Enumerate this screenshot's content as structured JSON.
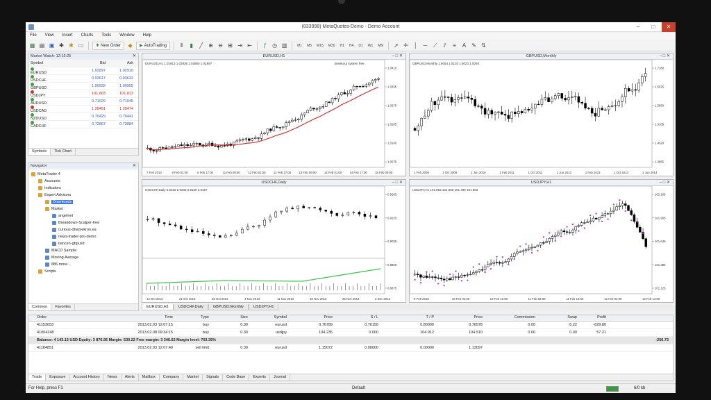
{
  "window": {
    "title": "(833998) MetaQuotes-Demo - Demo Account"
  },
  "menu": [
    "File",
    "View",
    "Insert",
    "Charts",
    "Tools",
    "Window",
    "Help"
  ],
  "toolbar": {
    "new_order": "New Order",
    "autotrading": "AutoTrading",
    "timeframes": [
      "M1",
      "M5",
      "M15",
      "M30",
      "H1",
      "H4",
      "D1",
      "W1",
      "MN"
    ]
  },
  "market_watch": {
    "title": "Market Watch: 12:15:25",
    "columns": [
      "Symbol",
      "Bid",
      "Ask"
    ],
    "rows": [
      {
        "symbol": "EURUSD",
        "bid": "1.02897",
        "ask": "1.02910",
        "down": false
      },
      {
        "symbol": "USDCHF",
        "bid": "0.93617",
        "ask": "0.93632",
        "down": false
      },
      {
        "symbol": "GBPUSD",
        "bid": "1.50939",
        "ask": "1.50955",
        "down": false
      },
      {
        "symbol": "USDJPY",
        "bid": "101.803",
        "ask": "101.813",
        "down": true
      },
      {
        "symbol": "AUDUSD",
        "bid": "0.71029",
        "ask": "0.71045",
        "down": false
      },
      {
        "symbol": "USDCAD",
        "bid": "1.28451",
        "ask": "1.28474",
        "down": true
      },
      {
        "symbol": "NZDUSD",
        "bid": "0.70429",
        "ask": "0.70441",
        "down": false
      },
      {
        "symbol": "CADCHF",
        "bid": "0.72867",
        "ask": "0.72884",
        "down": false
      }
    ],
    "tabs": [
      "Symbols",
      "Tick Chart"
    ]
  },
  "navigator": {
    "title": "Navigator",
    "items": [
      {
        "label": "MetaTrader 4",
        "level": 0,
        "icon": "folder",
        "sel": false
      },
      {
        "label": "Accounts",
        "level": 1,
        "icon": "folder",
        "sel": false
      },
      {
        "label": "Indicators",
        "level": 1,
        "icon": "folder",
        "sel": false
      },
      {
        "label": "Expert Advisors",
        "level": 1,
        "icon": "folder",
        "sel": false
      },
      {
        "label": "Downloads",
        "level": 2,
        "icon": "folder",
        "sel": true
      },
      {
        "label": "Market",
        "level": 2,
        "icon": "folder",
        "sel": false
      },
      {
        "label": "angelnet",
        "level": 3,
        "icon": "robot",
        "sel": false
      },
      {
        "label": "Breakdown-Scalper-free",
        "level": 3,
        "icon": "robot",
        "sel": false
      },
      {
        "label": "curious-dhamekron.ea",
        "level": 3,
        "icon": "robot",
        "sel": false
      },
      {
        "label": "news-trader-pro-demo",
        "level": 3,
        "icon": "robot",
        "sel": false
      },
      {
        "label": "tiancen-gbpusd",
        "level": 3,
        "icon": "robot",
        "sel": false
      },
      {
        "label": "MACD Sample",
        "level": 2,
        "icon": "robot",
        "sel": false
      },
      {
        "label": "Moving Average",
        "level": 2,
        "icon": "robot",
        "sel": false
      },
      {
        "label": "886 more...",
        "level": 2,
        "icon": "robot",
        "sel": false
      },
      {
        "label": "Scripts",
        "level": 1,
        "icon": "folder",
        "sel": false
      }
    ],
    "tabs": [
      "Common",
      "Favorites"
    ]
  },
  "charts": [
    {
      "title": "EURUSD,H1",
      "info": "EURUSD,H1  1.02913 1.02936 1.02880 1.02897",
      "label": "Breakout system free",
      "prices": [
        "1.0410",
        "1.0335",
        "1.0270",
        "1.0205",
        "1.0140",
        "1.0075"
      ],
      "dates": [
        "7 Feb 2013",
        "8 Feb 01:00",
        "8 Feb 17:00",
        "11 Feb 09:00",
        "12 Feb 01:00",
        "12 Feb 17:00",
        "13 Feb 09:00",
        "14 Feb 01:00",
        "14 Feb 17:00",
        "15 Feb 09:00"
      ]
    },
    {
      "title": "GBPUSD,Monthly",
      "info": "GBPUSD,Monthly  1.5054 1.5102 1.5023 1.5093",
      "label": "",
      "prices": [
        "1.7180",
        "1.6515",
        "1.5850",
        "1.5185",
        "1.4520",
        "1.3855"
      ],
      "dates": [
        "1 Feb 2009",
        "1 Oct 2009",
        "1 Jun 2010",
        "1 Feb 2011",
        "1 Oct 2011",
        "1 Jun 2012",
        "1 Feb 2013",
        "1 Oct 2013",
        "1 Jun 2014"
      ]
    },
    {
      "title": "USDCHF,Daily",
      "info": "USDCHF,Daily  0.9182 0.9203 0.9150 0.9157",
      "label": "",
      "prices": [
        "0.9205",
        "0.9120",
        "0.9035",
        "0.8950",
        "0.8875"
      ],
      "dates": [
        "14 Oct 2013",
        "21 Oct 2013",
        "28 Oct 2013",
        "4 Nov 2013",
        "11 Nov 2013",
        "18 Nov 2013",
        "25 Nov 2013",
        "2 Dec 2013"
      ]
    },
    {
      "title": "USDJPY,H1",
      "info": "USDJPY,H1  101.853 101.858 101.789 101.803",
      "label": "",
      "prices": [
        "102.165",
        "101.905",
        "101.645",
        "101.385",
        "101.125"
      ],
      "dates": [
        "9 Feb 2016",
        "10 Feb 02:00",
        "10 Feb 12:00",
        "11 Feb 02:00",
        "11 Feb 12:00",
        "12 Feb 02:00",
        "12 Feb 12:00"
      ]
    }
  ],
  "chart_tabs": [
    "EURUSD,H1",
    "USDCHF,Daily",
    "GBPUSD,Monthly",
    "USDJPY,H1"
  ],
  "terminal": {
    "columns": [
      "Order",
      "Time",
      "Type",
      "Size",
      "Symbol",
      "Price",
      "S / L",
      "T / P",
      "Price",
      "Commission",
      "Swap",
      "Profit"
    ],
    "rows": [
      [
        "41153053",
        "2013.02.03 12:07:15",
        "buy",
        "0.30",
        "eurusd",
        "0.76789",
        "0.76150",
        "0.80000",
        "0.76578",
        "0.00",
        "-5.22",
        "-629.80"
      ],
      [
        "41004248",
        "2013.02.08 09:34:15",
        "buy",
        "0.30",
        "usdjpy",
        "104.235",
        "0.000",
        "104.912",
        "104.510",
        "0.00",
        "0.00",
        "57.21"
      ]
    ],
    "balance": "Balance: 4 143.13 USD  Equity: 3 876.95  Margin: 530.22  Free margin: 3 346.62  Margin level: 703.35%",
    "balance_profit": "-256.73",
    "order": [
      "41184851",
      "2013.02.03 12:07:40",
      "sell limit",
      "0.30",
      "eurusd",
      "1.15072",
      "0.00000",
      "0.00000",
      "1.13097",
      "",
      "",
      ""
    ],
    "tabs": [
      "Trade",
      "Exposure",
      "Account History",
      "News",
      "Alerts",
      "Mailbox",
      "Company",
      "Market",
      "Signals",
      "Code Base",
      "Experts",
      "Journal"
    ]
  },
  "status": {
    "left": "For Help, press F1",
    "profile": "Default",
    "traffic": "6/0 kb"
  }
}
